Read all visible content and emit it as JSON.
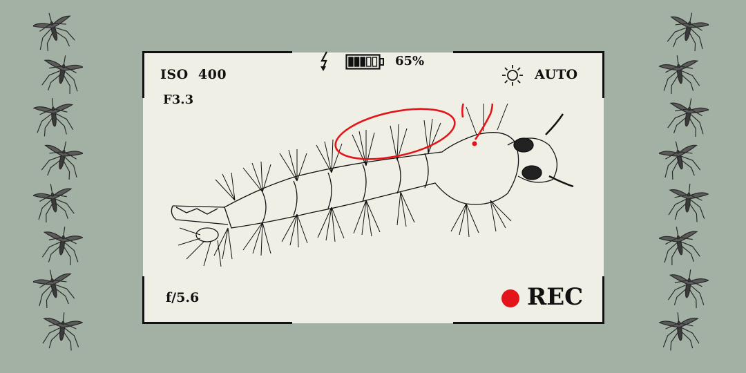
{
  "hud": {
    "iso": "ISO  400",
    "aperture_top": "F3.3",
    "aperture_bottom": "f/5.6",
    "battery_percent": "65%",
    "battery_level": 0.65,
    "white_balance": "AUTO",
    "record_label": "REC"
  },
  "icons": {
    "flash": "flash-icon",
    "battery": "battery-icon",
    "sun": "sun-icon",
    "record": "record-dot-icon",
    "side_decoration": "mosquito-icon"
  },
  "colors": {
    "background": "#a2b1a4",
    "viewfinder": "#efefe5",
    "ink": "#111111",
    "annotation_red": "#e3151a"
  },
  "illustration": {
    "subject": "mosquito larva sketch"
  }
}
